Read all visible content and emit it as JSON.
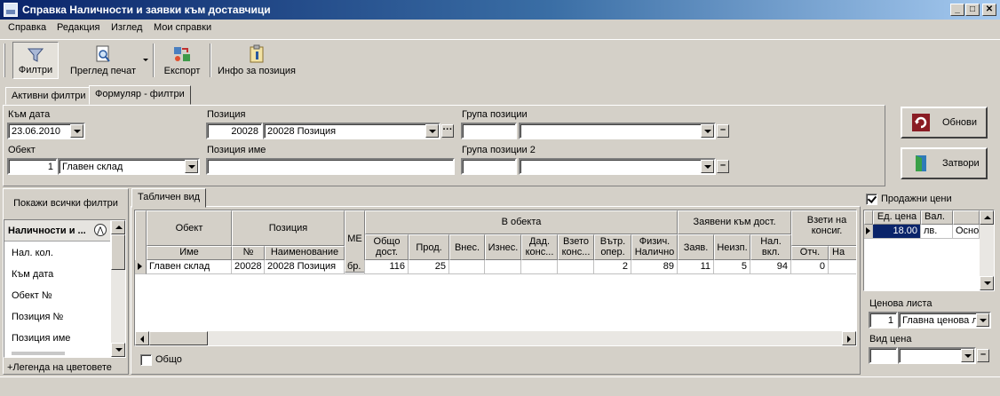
{
  "window": {
    "title": "Справка Наличности и заявки към доставчици"
  },
  "menu": [
    "Справка",
    "Редакция",
    "Изглед",
    "Мои справки"
  ],
  "toolbar": {
    "filters": "Филтри",
    "print_preview": "Преглед печат",
    "export": "Експорт",
    "position_info": "Инфо за позиция"
  },
  "filter_tabs": [
    "Активни филтри",
    "Формуляр - филтри"
  ],
  "form": {
    "to_date_label": "Към дата",
    "to_date_value": "23.06.2010",
    "object_label": "Обект",
    "object_code": "1",
    "object_name": "Главен склад",
    "position_label": "Позиция",
    "position_code": "20028",
    "position_name": "20028 Позиция",
    "position_name_label": "Позиция име",
    "position_name_value": "",
    "group_label": "Група позиции",
    "group2_label": "Група позиции 2"
  },
  "buttons": {
    "refresh": "Обнови",
    "close": "Затвори",
    "show_all_filters": "Покажи всички филтри",
    "color_legend": "+Легенда на цветовете"
  },
  "left_list": {
    "header": "Наличности и ...",
    "items": [
      "Нал. кол.",
      "Към дата",
      "Обект №",
      "Позиция №",
      "Позиция име"
    ]
  },
  "grid": {
    "tab": "Табличен вид",
    "headers": {
      "object": "Обект",
      "object_name": "Име",
      "position": "Позиция",
      "position_no": "№",
      "position_name": "Наименование",
      "unit": "МЕ",
      "in_object": "В обекта",
      "requested": "Заявени към дост.",
      "consign": "Взети на консиг.",
      "cols": {
        "total": "Общо дост.",
        "sale": "Прод.",
        "in": "Внес.",
        "out": "Изнес.",
        "given_consign": "Дад. конс...",
        "taken_consign": "Взето конс...",
        "internal": "Вътр. опер.",
        "physical": "Физич. Налично",
        "req": "Заяв.",
        "unfulfilled": "Неизп.",
        "incl_unfulfilled": "Нал. вкл. неизп.",
        "report": "Отч.",
        "na": "На"
      }
    },
    "rows": [
      {
        "object_name": "Главен склад",
        "position_no": "20028",
        "position_name": "20028 Позиция",
        "unit": "бр.",
        "total": "116",
        "sale": "25",
        "in": "",
        "out": "",
        "given_consign": "",
        "taken_consign": "",
        "internal": "2",
        "physical": "89",
        "req": "11",
        "unfulfilled": "5",
        "incl_unfulfilled": "94",
        "report": "0",
        "na": ""
      }
    ],
    "total_label": "Общо"
  },
  "right_panel": {
    "sale_prices_label": "Продажни цени",
    "sale_prices_checked": true,
    "headers": [
      "Ед. цена",
      "Вал.",
      ""
    ],
    "row": [
      "18.00",
      "лв.",
      "Осно"
    ],
    "price_list_label": "Ценова листа",
    "price_list_code": "1",
    "price_list_name": "Главна ценова л",
    "price_type_label": "Вид цена"
  }
}
